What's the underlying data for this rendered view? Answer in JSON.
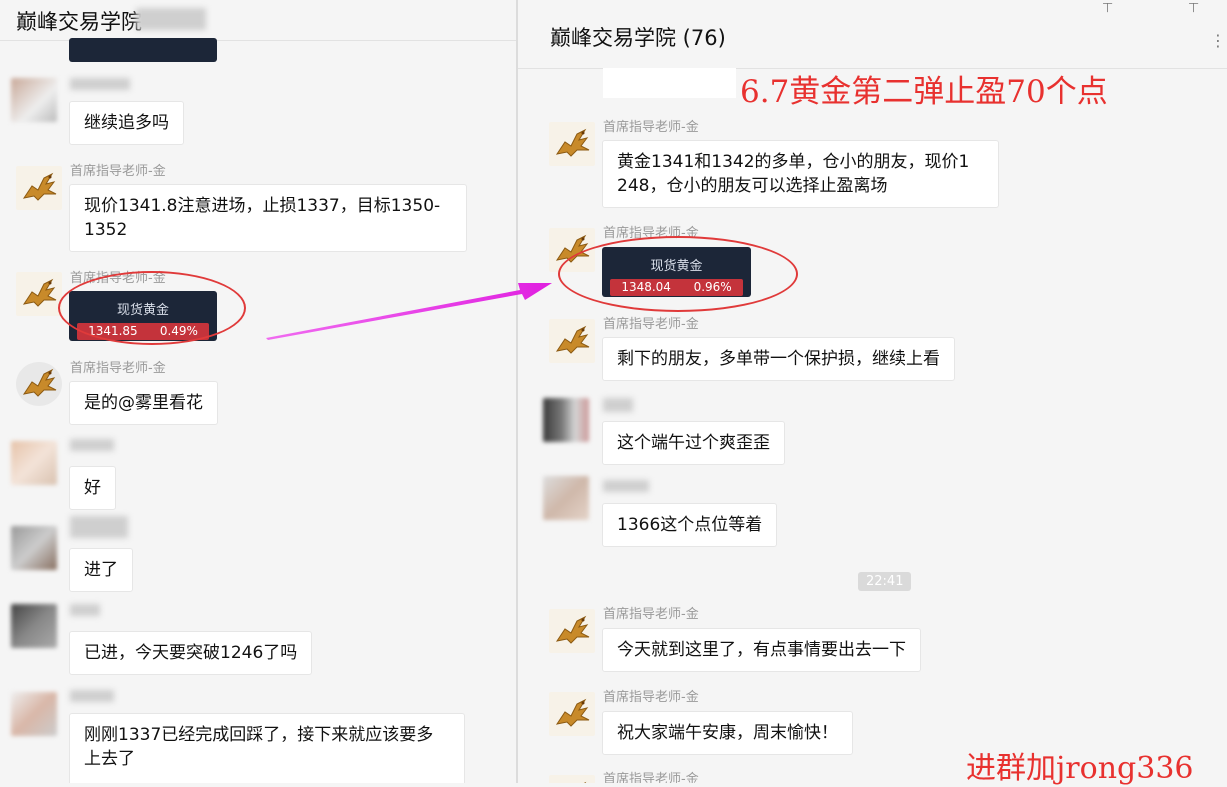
{
  "left_chat": {
    "title": "巅峰交易学院",
    "messages": [
      {
        "sender": "",
        "text": "继续追多吗"
      },
      {
        "sender": "首席指导老师-金",
        "text": "现价1341.8注意进场，止损1337，目标1350-\n1352"
      },
      {
        "sender": "首席指导老师-金",
        "quote": {
          "title": "现货黄金",
          "price": "1341.85",
          "change": "0.49%"
        }
      },
      {
        "sender": "首席指导老师-金",
        "text": "是的@雾里看花"
      },
      {
        "sender": "",
        "text": "好"
      },
      {
        "sender": "",
        "text": "进了"
      },
      {
        "sender": "",
        "text": "已进，今天要突破1246了吗"
      },
      {
        "sender": "",
        "text": "刚刚1337已经完成回踩了，接下来就应该要多\n上去了"
      }
    ]
  },
  "right_chat": {
    "title": "巅峰交易学院 (76)",
    "annotation": "6.7黄金第二弹止盈70个点",
    "messages": [
      {
        "sender": "首席指导老师-金",
        "text": "黄金1341和1342的多单，仓小的朋友，现价1\n248，仓小的朋友可以选择止盈离场"
      },
      {
        "sender": "首席指导老师-金",
        "quote": {
          "title": "现货黄金",
          "price": "1348.04",
          "change": "0.96%"
        }
      },
      {
        "sender": "首席指导老师-金",
        "text": "剩下的朋友，多单带一个保护损，继续上看"
      },
      {
        "sender": "",
        "text": "这个端午过个爽歪歪"
      },
      {
        "sender": "",
        "text": "1366这个点位等着"
      },
      {
        "time": "22:41"
      },
      {
        "sender": "首席指导老师-金",
        "text": "今天就到这里了，有点事情要出去一下"
      },
      {
        "sender": "首席指导老师-金",
        "text": "祝大家端午安康，周末愉快！"
      },
      {
        "sender": "首席指导老师-金",
        "text": ""
      }
    ]
  },
  "watermark": "进群加jrong336",
  "colors": {
    "annotation_red": "#e8312f",
    "arrow_magenta": "#e83ee8",
    "quote_bg": "#1c2638",
    "quote_red": "#c4333b"
  },
  "icons": {
    "teacher_avatar": "golden-pegasus-icon",
    "window_pin": "pin-icon",
    "window_more": "more-icon"
  }
}
